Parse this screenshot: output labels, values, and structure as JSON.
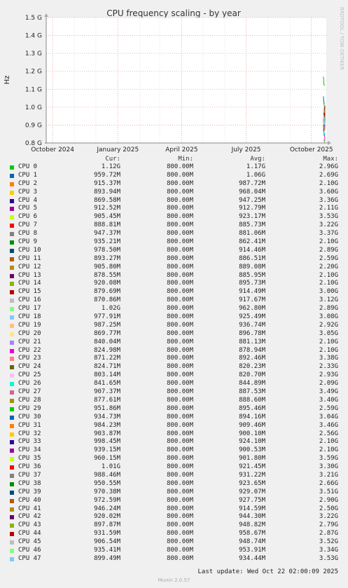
{
  "chart_data": {
    "type": "line",
    "title": "CPU frequency scaling - by year",
    "ylabel": "Hz",
    "side_label": "RRDTOOL / TOBI OETIKER",
    "yticks": [
      "1.5 G",
      "1.4 G",
      "1.3 G",
      "1.2 G",
      "1.1 G",
      "1.0 G",
      "0.9 G",
      "0.8 G"
    ],
    "ytick_values": [
      1.5,
      1.4,
      1.3,
      1.2,
      1.1,
      1.0,
      0.9,
      0.8
    ],
    "ylim": [
      0.8,
      1.5
    ],
    "xticks": [
      "October 2024",
      "January 2025",
      "April 2025",
      "July 2025",
      "October 2025"
    ],
    "xtick_values": [
      "2024-10-01",
      "2025-01-01",
      "2025-04-01",
      "2025-07-01",
      "2025-10-01"
    ],
    "xlim": [
      "2024-09-22",
      "2025-10-22"
    ],
    "data_start": "2025-10-18",
    "grid": true,
    "legend_placement": "below",
    "legend_columns": [
      "Cur:",
      "Min:",
      "Avg:",
      "Max:"
    ],
    "series": [
      {
        "name": "CPU 0",
        "color": "#00cc00",
        "cur": "1.12G",
        "min": "800.00M",
        "avg": "1.17G",
        "max": "2.96G"
      },
      {
        "name": "CPU 1",
        "color": "#0066b3",
        "cur": "959.72M",
        "min": "800.00M",
        "avg": "1.06G",
        "max": "2.69G"
      },
      {
        "name": "CPU 2",
        "color": "#ff8000",
        "cur": "915.37M",
        "min": "800.00M",
        "avg": "987.72M",
        "max": "2.10G"
      },
      {
        "name": "CPU 3",
        "color": "#ffcc00",
        "cur": "893.94M",
        "min": "800.00M",
        "avg": "968.04M",
        "max": "3.60G"
      },
      {
        "name": "CPU 4",
        "color": "#330099",
        "cur": "869.58M",
        "min": "800.00M",
        "avg": "947.25M",
        "max": "3.36G"
      },
      {
        "name": "CPU 5",
        "color": "#990099",
        "cur": "912.52M",
        "min": "800.00M",
        "avg": "912.79M",
        "max": "2.11G"
      },
      {
        "name": "CPU 6",
        "color": "#ccff00",
        "cur": "905.45M",
        "min": "800.00M",
        "avg": "923.17M",
        "max": "3.53G"
      },
      {
        "name": "CPU 7",
        "color": "#ff0000",
        "cur": "888.81M",
        "min": "800.00M",
        "avg": "885.73M",
        "max": "3.22G"
      },
      {
        "name": "CPU 8",
        "color": "#808080",
        "cur": "947.37M",
        "min": "800.00M",
        "avg": "881.06M",
        "max": "3.37G"
      },
      {
        "name": "CPU 9",
        "color": "#008f00",
        "cur": "935.21M",
        "min": "800.00M",
        "avg": "862.41M",
        "max": "2.10G"
      },
      {
        "name": "CPU 10",
        "color": "#00487d",
        "cur": "978.50M",
        "min": "800.00M",
        "avg": "914.46M",
        "max": "2.89G"
      },
      {
        "name": "CPU 11",
        "color": "#b35a00",
        "cur": "893.27M",
        "min": "800.00M",
        "avg": "886.51M",
        "max": "2.59G"
      },
      {
        "name": "CPU 12",
        "color": "#b38f00",
        "cur": "905.80M",
        "min": "800.00M",
        "avg": "889.08M",
        "max": "2.20G"
      },
      {
        "name": "CPU 13",
        "color": "#6b006b",
        "cur": "878.55M",
        "min": "800.00M",
        "avg": "885.95M",
        "max": "2.10G"
      },
      {
        "name": "CPU 14",
        "color": "#8fb300",
        "cur": "920.08M",
        "min": "800.00M",
        "avg": "895.73M",
        "max": "2.10G"
      },
      {
        "name": "CPU 15",
        "color": "#b30000",
        "cur": "879.69M",
        "min": "800.00M",
        "avg": "914.49M",
        "max": "3.00G"
      },
      {
        "name": "CPU 16",
        "color": "#bebebe",
        "cur": "870.86M",
        "min": "800.00M",
        "avg": "917.67M",
        "max": "3.12G"
      },
      {
        "name": "CPU 17",
        "color": "#80ff80",
        "cur": "1.02G",
        "min": "800.00M",
        "avg": "962.80M",
        "max": "2.89G"
      },
      {
        "name": "CPU 18",
        "color": "#80c9ff",
        "cur": "977.91M",
        "min": "800.00M",
        "avg": "925.49M",
        "max": "3.08G"
      },
      {
        "name": "CPU 19",
        "color": "#ffc080",
        "cur": "987.25M",
        "min": "800.00M",
        "avg": "936.74M",
        "max": "2.92G"
      },
      {
        "name": "CPU 20",
        "color": "#ffe680",
        "cur": "869.77M",
        "min": "800.00M",
        "avg": "896.78M",
        "max": "3.05G"
      },
      {
        "name": "CPU 21",
        "color": "#aa80ff",
        "cur": "840.04M",
        "min": "800.00M",
        "avg": "881.13M",
        "max": "2.10G"
      },
      {
        "name": "CPU 22",
        "color": "#ee00cc",
        "cur": "824.98M",
        "min": "800.00M",
        "avg": "878.94M",
        "max": "2.10G"
      },
      {
        "name": "CPU 23",
        "color": "#ff8080",
        "cur": "871.22M",
        "min": "800.00M",
        "avg": "892.46M",
        "max": "3.38G"
      },
      {
        "name": "CPU 24",
        "color": "#666600",
        "cur": "824.71M",
        "min": "800.00M",
        "avg": "820.23M",
        "max": "2.33G"
      },
      {
        "name": "CPU 25",
        "color": "#ffbfff",
        "cur": "803.14M",
        "min": "800.00M",
        "avg": "820.70M",
        "max": "2.93G"
      },
      {
        "name": "CPU 26",
        "color": "#00ffcc",
        "cur": "841.65M",
        "min": "800.00M",
        "avg": "844.89M",
        "max": "2.09G"
      },
      {
        "name": "CPU 27",
        "color": "#cc6699",
        "cur": "907.37M",
        "min": "800.00M",
        "avg": "887.53M",
        "max": "3.49G"
      },
      {
        "name": "CPU 28",
        "color": "#999900",
        "cur": "877.61M",
        "min": "800.00M",
        "avg": "888.60M",
        "max": "3.40G"
      },
      {
        "name": "CPU 29",
        "color": "#00cc00",
        "cur": "951.86M",
        "min": "800.00M",
        "avg": "895.46M",
        "max": "2.59G"
      },
      {
        "name": "CPU 30",
        "color": "#0066b3",
        "cur": "934.73M",
        "min": "800.00M",
        "avg": "894.16M",
        "max": "3.04G"
      },
      {
        "name": "CPU 31",
        "color": "#ff8000",
        "cur": "984.23M",
        "min": "800.00M",
        "avg": "909.46M",
        "max": "3.46G"
      },
      {
        "name": "CPU 32",
        "color": "#ffcc00",
        "cur": "903.87M",
        "min": "800.00M",
        "avg": "900.10M",
        "max": "2.56G"
      },
      {
        "name": "CPU 33",
        "color": "#330099",
        "cur": "998.45M",
        "min": "800.00M",
        "avg": "924.10M",
        "max": "2.10G"
      },
      {
        "name": "CPU 34",
        "color": "#990099",
        "cur": "939.15M",
        "min": "800.00M",
        "avg": "900.53M",
        "max": "2.10G"
      },
      {
        "name": "CPU 35",
        "color": "#ccff00",
        "cur": "960.15M",
        "min": "800.00M",
        "avg": "901.80M",
        "max": "3.59G"
      },
      {
        "name": "CPU 36",
        "color": "#ff0000",
        "cur": "1.01G",
        "min": "800.00M",
        "avg": "921.45M",
        "max": "3.30G"
      },
      {
        "name": "CPU 37",
        "color": "#808080",
        "cur": "988.46M",
        "min": "800.00M",
        "avg": "931.22M",
        "max": "3.21G"
      },
      {
        "name": "CPU 38",
        "color": "#008f00",
        "cur": "950.55M",
        "min": "800.00M",
        "avg": "923.65M",
        "max": "2.66G"
      },
      {
        "name": "CPU 39",
        "color": "#00487d",
        "cur": "970.38M",
        "min": "800.00M",
        "avg": "929.07M",
        "max": "3.51G"
      },
      {
        "name": "CPU 40",
        "color": "#b35a00",
        "cur": "972.59M",
        "min": "800.00M",
        "avg": "927.75M",
        "max": "2.90G"
      },
      {
        "name": "CPU 41",
        "color": "#b38f00",
        "cur": "946.24M",
        "min": "800.00M",
        "avg": "914.59M",
        "max": "2.50G"
      },
      {
        "name": "CPU 42",
        "color": "#6b006b",
        "cur": "920.02M",
        "min": "800.00M",
        "avg": "944.30M",
        "max": "3.22G"
      },
      {
        "name": "CPU 43",
        "color": "#8fb300",
        "cur": "897.87M",
        "min": "800.00M",
        "avg": "948.82M",
        "max": "2.79G"
      },
      {
        "name": "CPU 44",
        "color": "#b30000",
        "cur": "931.59M",
        "min": "800.00M",
        "avg": "958.67M",
        "max": "2.87G"
      },
      {
        "name": "CPU 45",
        "color": "#bebebe",
        "cur": "906.54M",
        "min": "800.00M",
        "avg": "948.74M",
        "max": "3.52G"
      },
      {
        "name": "CPU 46",
        "color": "#80ff80",
        "cur": "935.41M",
        "min": "800.00M",
        "avg": "953.91M",
        "max": "3.34G"
      },
      {
        "name": "CPU 47",
        "color": "#80c9ff",
        "cur": "899.49M",
        "min": "800.00M",
        "avg": "934.44M",
        "max": "3.53G"
      }
    ]
  },
  "footer": {
    "last_update": "Last update: Wed Oct 22 02:00:09 2025",
    "version": "Munin 2.0.57"
  }
}
